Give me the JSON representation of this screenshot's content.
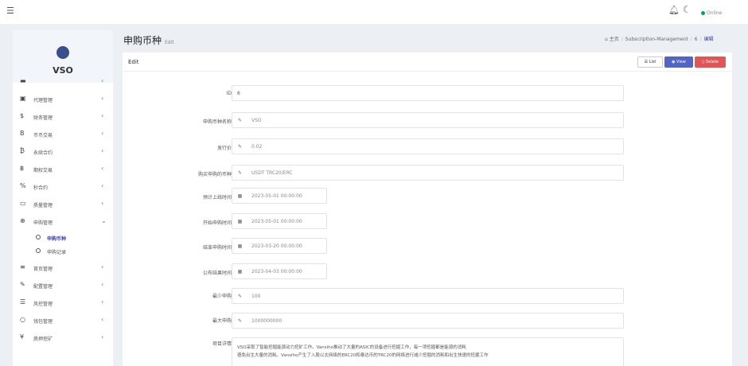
{
  "topbar": {
    "online_label": "Online"
  },
  "sidebar": {
    "logo_text": "VSO",
    "items": [
      {
        "label": "代理管理",
        "icon": "id-card-icon",
        "glyph": "▣"
      },
      {
        "label": "财务管理",
        "icon": "dollar-icon",
        "glyph": "$"
      },
      {
        "label": "币币交易",
        "icon": "bitcoin-icon",
        "glyph": "B"
      },
      {
        "label": "永续合约",
        "icon": "bitcoin-icon",
        "glyph": "₿"
      },
      {
        "label": "期权交易",
        "icon": "bitcoin-icon",
        "glyph": "฿"
      },
      {
        "label": "秒合约",
        "icon": "percent-icon",
        "glyph": "%"
      },
      {
        "label": "质量管理",
        "icon": "card-icon",
        "glyph": "▭"
      }
    ],
    "active_item": {
      "label": "申购管理",
      "icon": "lifebuoy-icon",
      "glyph": "⊕"
    },
    "sub_items": [
      {
        "label": "申购币种",
        "active": true
      },
      {
        "label": "申购记录",
        "active": false
      }
    ],
    "items_after": [
      {
        "label": "首页管理",
        "icon": "bars-icon",
        "glyph": "≡"
      },
      {
        "label": "配置管理",
        "icon": "wrench-icon",
        "glyph": "✎"
      },
      {
        "label": "风控管理",
        "icon": "list-icon",
        "glyph": "☰"
      },
      {
        "label": "钱包管理",
        "icon": "circle-icon",
        "glyph": "○"
      },
      {
        "label": "质押挖矿",
        "icon": "yen-icon",
        "glyph": "¥"
      }
    ]
  },
  "header": {
    "title": "申购币种",
    "subtitle": "Edit",
    "breadcrumb": {
      "home": "主页",
      "section": "Subscription-Management",
      "id": "6",
      "current": "编辑"
    }
  },
  "panel": {
    "title": "Edit",
    "buttons": {
      "list": "List",
      "view": "View",
      "delete": "Delete"
    }
  },
  "form": {
    "id": {
      "label": "ID",
      "value": "6"
    },
    "name": {
      "label": "申购币种名称",
      "value": "VSO"
    },
    "price": {
      "label": "发行价",
      "value": "0.02"
    },
    "pay_coin": {
      "label": "购买申购的币种",
      "value": "USDT TRC20/ERC"
    },
    "expected_time": {
      "label": "预计上线时间",
      "value": "2023-05-01 00:00:00"
    },
    "start_time": {
      "label": "开始申购时间",
      "value": "2023-05-01 00:00:00"
    },
    "end_time": {
      "label": "结束申购时间",
      "value": "2023-03-20 00:00:00"
    },
    "announce_time": {
      "label": "公布结果时间",
      "value": "2023-04-03 00:00:00"
    },
    "min": {
      "label": "最少申购",
      "value": "100"
    },
    "max": {
      "label": "最大申购",
      "value": "1000000000"
    },
    "details": {
      "label": "项目详情",
      "line1": "VSO采取了智能挖掘能源动力挖矿工作。Vansiho推动了大量的ASIC的设备进行挖掘工作，每一项挖掘都是能源的消耗",
      "line2": "避免出生大量的消耗。Vansiho产生了入股以太网络的ERC20和泰达币的TRC20的网络进行减少挖掘的消耗和出生快速的挖掘工作"
    }
  }
}
